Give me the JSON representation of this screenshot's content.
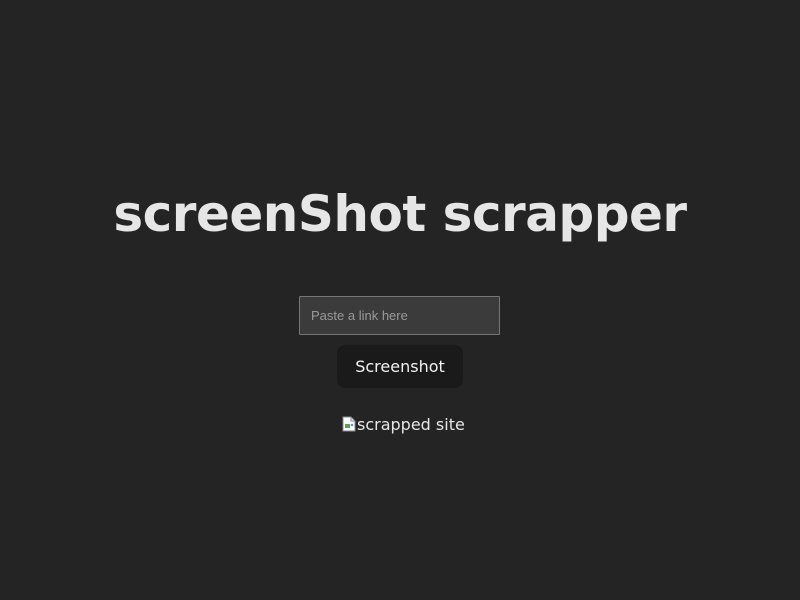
{
  "app": {
    "title": "screenShot scrapper"
  },
  "form": {
    "url_placeholder": "Paste a link here",
    "url_value": "",
    "submit_label": "Screenshot"
  },
  "result": {
    "image_alt": "scrapped site",
    "icon": "broken-image-icon"
  },
  "colors": {
    "background": "#242424",
    "button_background": "#1a1a1a",
    "input_background": "#3b3b3b",
    "text": "#e6e6e6"
  }
}
